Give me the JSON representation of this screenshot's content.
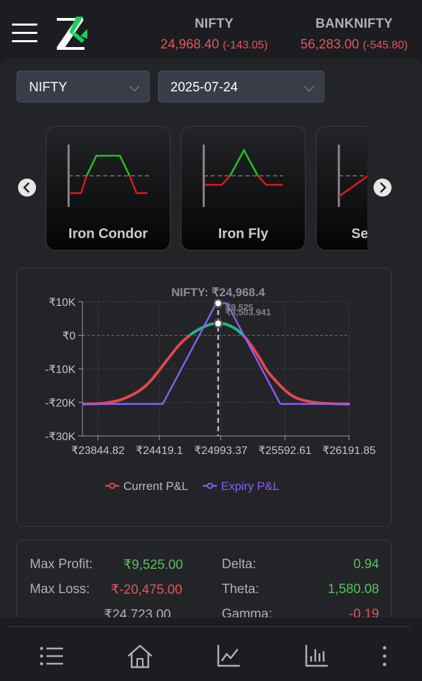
{
  "header": {
    "tickers": [
      {
        "name": "NIFTY",
        "price": "24,968.40",
        "change": "(-143.05)"
      },
      {
        "name": "BANKNIFTY",
        "price": "56,283.00",
        "change": "(-545.80)"
      }
    ]
  },
  "selectors": {
    "symbol": "NIFTY",
    "expiry": "2025-07-24"
  },
  "strategies": [
    {
      "label": "Iron Condor",
      "icon": "iron-condor-payoff-icon"
    },
    {
      "label": "Iron Fly",
      "icon": "iron-fly-payoff-icon"
    },
    {
      "label": "Se",
      "icon": "spread-payoff-icon"
    }
  ],
  "chart_data": {
    "type": "line",
    "annotation": "NIFTY: ₹24,968.4",
    "marker_labels": [
      "₹9,525",
      "₹3,503.941"
    ],
    "spot": 24968.4,
    "y_ticks": [
      "₹10K",
      "₹0",
      "-₹10K",
      "-₹20K",
      "-₹30K"
    ],
    "y_tick_values": [
      10000,
      0,
      -10000,
      -20000,
      -30000
    ],
    "x_ticks": [
      "₹23844.82",
      "₹24419.1",
      "₹24993.37",
      "₹25592.61",
      "₹26191.85"
    ],
    "x_tick_values": [
      23844.82,
      24419.1,
      24993.37,
      25592.61,
      26191.85
    ],
    "xlim": [
      23700,
      26200
    ],
    "ylim": [
      -30000,
      10000
    ],
    "grid": true,
    "legend_position": "bottom",
    "series": [
      {
        "name": "Current P&L",
        "color": "#e2474e",
        "profit_color": "#21b88a",
        "x": [
          23700,
          23900,
          24100,
          24300,
          24500,
          24600,
          24700,
          24800,
          24900,
          24968.4,
          25050,
          25150,
          25250,
          25350,
          25450,
          25650,
          25850,
          26050,
          26200
        ],
        "y": [
          -20475,
          -20200,
          -18700,
          -14800,
          -7000,
          -3000,
          -60,
          2000,
          3300,
          3504,
          3200,
          1500,
          -1800,
          -6500,
          -11500,
          -17800,
          -19900,
          -20400,
          -20475
        ]
      },
      {
        "name": "Expiry P&L",
        "color": "#8b5cf6",
        "x": [
          23700,
          24450,
          24950,
          25050,
          25550,
          26200
        ],
        "y": [
          -20475,
          -20475,
          9525,
          9525,
          -20475,
          -20475
        ]
      }
    ]
  },
  "stats": {
    "max_profit_label": "Max Profit:",
    "max_profit": "₹9,525.00",
    "max_loss_label": "Max Loss:",
    "max_loss": "₹-20,475.00",
    "breakeven": "₹24,723.00,",
    "delta_label": "Delta:",
    "delta": "0.94",
    "theta_label": "Theta:",
    "theta": "1,580.08",
    "gamma_label": "Gamma:",
    "gamma": "-0.19"
  },
  "bottom_nav": [
    "list-icon",
    "home-icon",
    "line-chart-icon",
    "bar-chart-icon",
    "more-vertical-icon"
  ],
  "colors": {
    "accent_green": "#5cc05c",
    "negative_red": "#e2575a",
    "panel_bg": "#232428",
    "page_bg": "#1c1d20"
  }
}
